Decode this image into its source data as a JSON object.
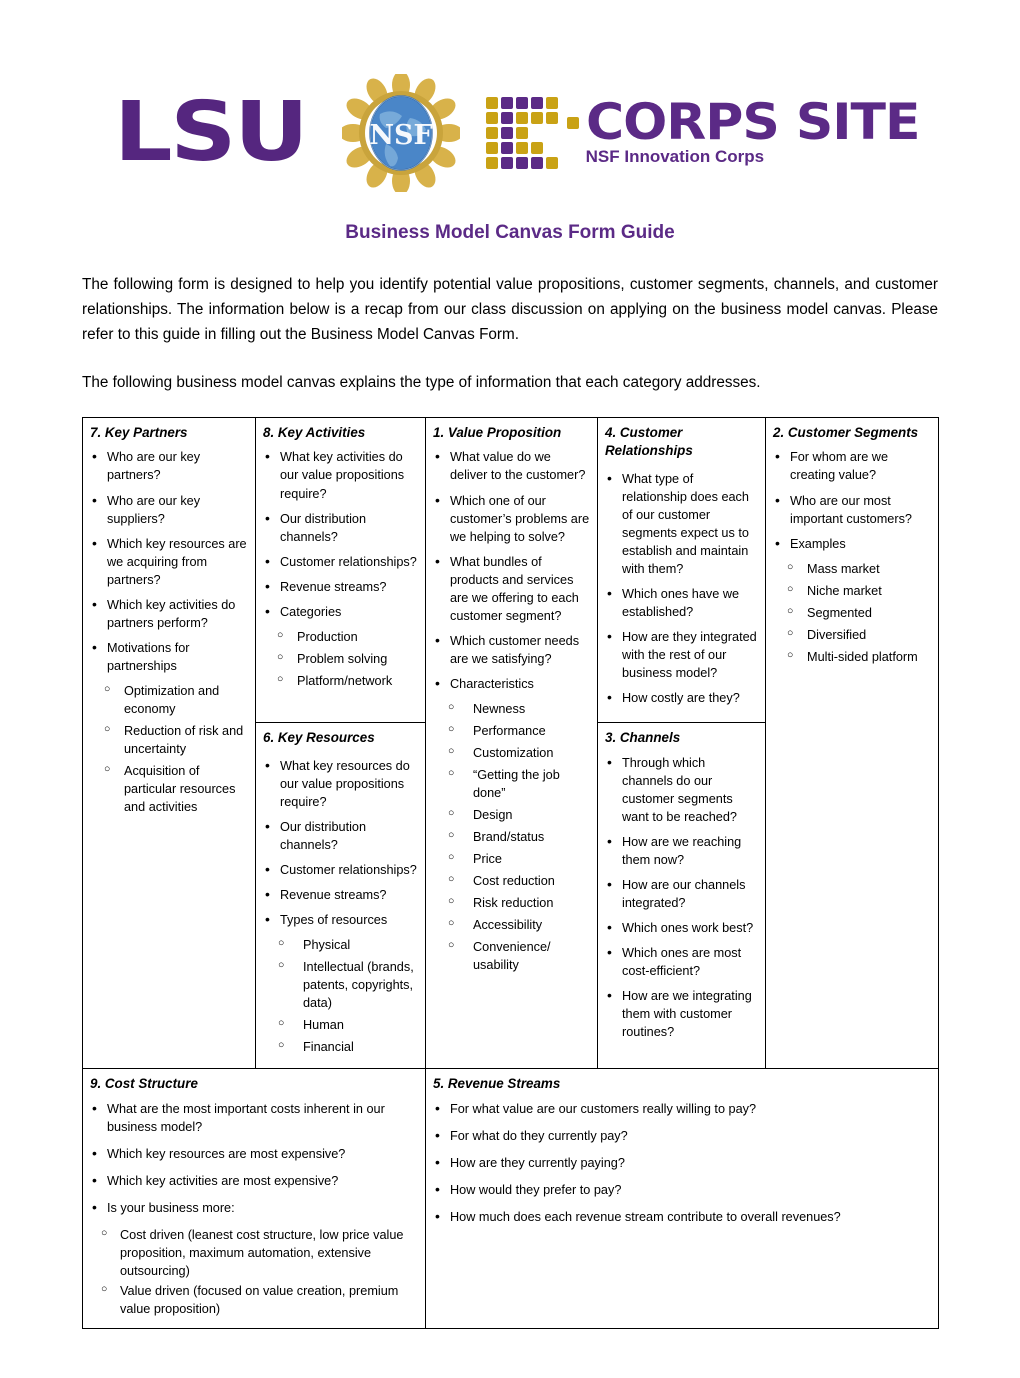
{
  "branding": {
    "lsu_text": "LSU",
    "nsf_text": "NSF",
    "icorps_word": "CORPS SITE",
    "icorps_subtitle": "NSF Innovation Corps",
    "purple": "#5b2a86",
    "gold": "#c9a215"
  },
  "document": {
    "title": "Business Model Canvas Form Guide",
    "intro_paragraph_1": "The following form is designed to help you identify potential value propositions, customer segments, channels, and customer relationships. The information below is a recap from our class discussion on applying on the business model canvas. Please refer to this guide in filling out the Business Model Canvas Form.",
    "intro_paragraph_2": "The following business model canvas explains the type of information that each category addresses."
  },
  "canvas": {
    "key_partners": {
      "heading": "7.  Key Partners",
      "items": [
        "Who are our key partners?",
        "Who are our key suppliers?",
        "Which key resources are we acquiring from partners?",
        "Which key activities do partners perform?",
        "Motivations for partnerships"
      ],
      "sub_items": [
        "Optimization and economy",
        "Reduction of risk and uncertainty",
        "Acquisition of particular resources and activities"
      ]
    },
    "key_activities": {
      "heading": "8. Key Activities",
      "items": [
        "What key activities do our value propositions require?",
        "Our distribution channels?",
        "Customer relationships?",
        "Revenue streams?",
        "Categories"
      ],
      "sub_items": [
        "Production",
        "Problem solving",
        "Platform/network"
      ]
    },
    "key_resources": {
      "heading": "6. Key Resources",
      "items": [
        "What key resources do our value propositions require?",
        "Our distribution channels?",
        "Customer relationships?",
        "Revenue streams?",
        "Types of resources"
      ],
      "sub_items": [
        "Physical",
        "Intellectual (brands, patents, copyrights, data)",
        "Human",
        "Financial"
      ]
    },
    "value_proposition": {
      "heading": "1. Value Proposition",
      "items": [
        "What value do we deliver to the customer?",
        "Which one of our customer’s problems are we helping to solve?",
        "What bundles of products and services are we offering to each customer segment?",
        "Which customer needs are we satisfying?",
        "Characteristics"
      ],
      "sub_items": [
        "Newness",
        "Performance",
        "Customization",
        "“Getting the job done”",
        "Design",
        "Brand/status",
        "Price",
        "Cost reduction",
        "Risk reduction",
        "Accessibility",
        "Convenience/ usability"
      ]
    },
    "customer_relationships": {
      "heading": "4. Customer Relationships",
      "items": [
        "What type of relationship does each of our customer segments expect us to establish and maintain with them?",
        "Which ones have we established?",
        "How are they integrated with the rest of our business model?",
        "How costly are they?"
      ]
    },
    "channels": {
      "heading": "3. Channels",
      "items": [
        "Through which channels do our customer segments want to be reached?",
        "How are we reaching them now?",
        "How are our channels integrated?",
        "Which ones work best?",
        "Which ones are most cost-efficient?",
        "How are we integrating them with customer routines?"
      ]
    },
    "customer_segments": {
      "heading": "2. Customer Segments",
      "items": [
        "For whom are we creating value?",
        "Who are our most important customers?",
        "Examples"
      ],
      "sub_items": [
        "Mass market",
        "Niche market",
        "Segmented",
        "Diversified",
        "Multi-sided platform"
      ]
    },
    "cost_structure": {
      "heading": "9. Cost Structure",
      "items": [
        "What are the most important costs inherent in our business model?",
        "Which key resources are most expensive?",
        "Which key activities are most expensive?",
        "Is your business more:"
      ],
      "sub_items": [
        "Cost driven (leanest cost structure, low price value proposition, maximum automation, extensive outsourcing)",
        "Value driven (focused on value creation, premium value proposition)"
      ]
    },
    "revenue_streams": {
      "heading": "5. Revenue Streams",
      "items": [
        "For what value are our customers really willing to pay?",
        "For what do they currently pay?",
        "How are they currently paying?",
        "How would they prefer to pay?",
        "How much does each revenue stream contribute to overall revenues?"
      ]
    }
  }
}
